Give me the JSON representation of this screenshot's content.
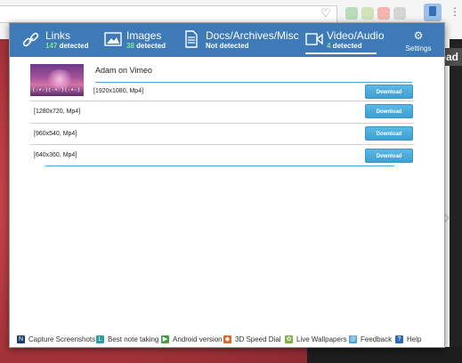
{
  "browser": {
    "star_icon": "star-icon",
    "side_button_label": "oad",
    "right_arrow": "›"
  },
  "tabs": [
    {
      "title": "Links",
      "count": "147",
      "suffix": "detected",
      "icon": "link-icon"
    },
    {
      "title": "Images",
      "count": "38",
      "suffix": "detected",
      "icon": "image-icon"
    },
    {
      "title": "Docs/Archives/Misc",
      "count": "",
      "suffix": "Not detected",
      "icon": "document-icon"
    },
    {
      "title": "Video/Audio",
      "count": "4",
      "suffix": "detected",
      "icon": "video-icon"
    }
  ],
  "settings": {
    "label": "Settings",
    "icon": "gear-icon"
  },
  "media": {
    "title": "Adam on Vimeo",
    "thumbnail_text": "(·•·)(·•·)(·•·)",
    "formats": [
      {
        "label": "[1920x1080, Mp4]",
        "button": "Download"
      },
      {
        "label": "[1280x720, Mp4]",
        "button": "Download"
      },
      {
        "label": "[960x540, Mp4]",
        "button": "Download"
      },
      {
        "label": "[640x360, Mp4]",
        "button": "Download"
      }
    ]
  },
  "footer": [
    {
      "label": "Capture Screenshots",
      "icon": "capture-icon",
      "icon_text": "N",
      "color": "#1d3c6e"
    },
    {
      "label": "Best note taking",
      "icon": "note-icon",
      "icon_text": "L",
      "color": "#2e9c9c"
    },
    {
      "label": "Android version",
      "icon": "play-store-icon",
      "icon_text": "▶",
      "color": "#43a047"
    },
    {
      "label": "3D Speed Dial",
      "icon": "speed-dial-icon",
      "icon_text": "◆",
      "color": "#e0662a"
    },
    {
      "label": "Live Wallpapers",
      "icon": "wallpaper-icon",
      "icon_text": "✿",
      "color": "#7cb342"
    },
    {
      "label": "Feedback",
      "icon": "feedback-icon",
      "icon_text": "@",
      "color": "#4a9fd8"
    },
    {
      "label": "Help",
      "icon": "help-icon",
      "icon_text": "?",
      "color": "#2d6cb5"
    }
  ]
}
